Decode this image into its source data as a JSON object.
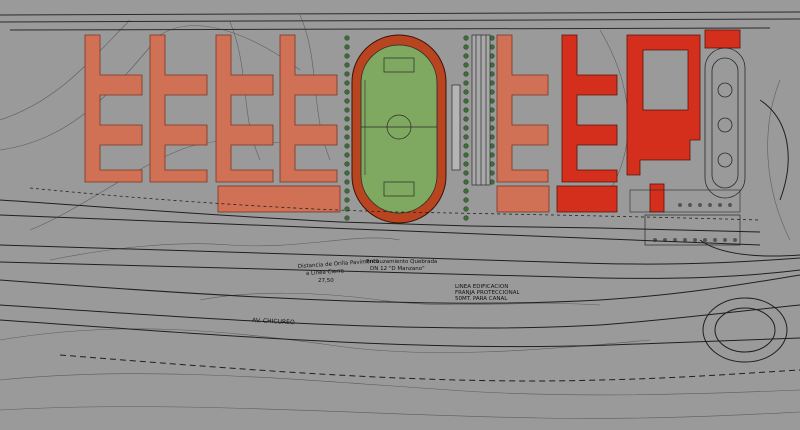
{
  "colors": {
    "background": "#9a9a9a",
    "existing_building": "#d07055",
    "new_building": "#d42e1c",
    "field_grass": "#7fa860",
    "track": "#b8451f",
    "line_work": "#2a2a2a",
    "tree": "#3f6a3a"
  },
  "annotations": {
    "setback_distance": "Distancia de Orilla Pavimento",
    "setback_ref": "a Linea Cierre",
    "setback_value": "27,50",
    "channel_encasement": "Encauzamiento Quebrada",
    "channel_ref": "DN 12 \"D Manzano\"",
    "building_line": "LINEA EDIFICACION",
    "protection_strip": "FRANJA PROTECCIONAL",
    "protection_strip_2": "50MT. PARA CANAL",
    "avenue": "AV. CHICUREO"
  }
}
